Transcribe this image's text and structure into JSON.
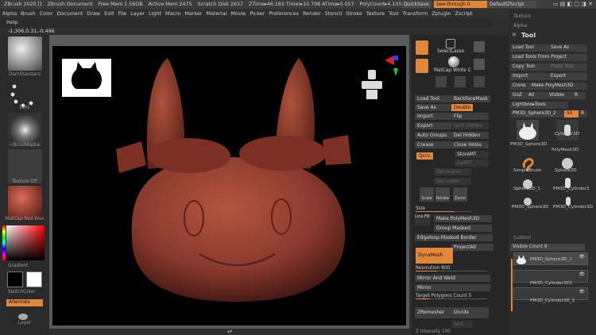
{
  "titlebar": {
    "app": "ZBrush 2020 []",
    "document": "ZBrush Document",
    "free_mem": "Free Mem 1.56GB",
    "active_mem": "Active Mem 2475",
    "scratch": "Scratch Disk 2637",
    "ztime": "ZTime▸46.183 Timer▸10.798 ATime▸0.057",
    "polycount": "PolyCount▸4.105 MP",
    "mi": "M…",
    "quicksave": "QuickSave",
    "see_through": "See-through  0",
    "script": "DefaultZScript"
  },
  "menu": [
    "Alpha",
    "Brush",
    "Color",
    "Document",
    "Draw",
    "Edit",
    "File",
    "Layer",
    "Light",
    "Macro",
    "Marker",
    "Material",
    "Movie",
    "Picker",
    "Preferences",
    "Render",
    "Stencil",
    "Stroke",
    "Texture",
    "Tool",
    "Transform",
    "Zplugin",
    "Zscript"
  ],
  "help": "Help",
  "coords": "-1.306,0.31,-0.496",
  "left_shelf": {
    "brush_label": "DamStandard",
    "stroke_label": "Dots",
    "alpha_label": "~BrushAlpha",
    "texture_label": "Texture Off",
    "material_label": "MatCap Red Wax",
    "gradient_label": "Gradient",
    "switch_label": "SwitchColor",
    "alternate_label": "Alternate",
    "layer_label": "Layer"
  },
  "center": {
    "lasso_label": "SelectLasso",
    "matcap_label": "MatCap White C",
    "brush_btns": [
      "Standard",
      "Clay Buildup",
      "Move",
      "Move Topo",
      "Smooth",
      "ZRemesher"
    ],
    "load_tool": "Load Tool",
    "backface": "BackfaceMask",
    "save_as": "Save As",
    "double": "Double",
    "import": "Import",
    "flip": "Flip",
    "export": "Export",
    "split_hidden": "Split Hidden",
    "auto_groups": "Auto Groups",
    "del_hidden": "Del Hidden",
    "crease": "Crease",
    "close_holes": "Close Holes",
    "qcrv": "Qcrv",
    "store_mt": "StoreMT",
    "del_mt": "DelMT",
    "del_higher": "Del Higher",
    "del_lower": "Del Lower",
    "scale": "Scale",
    "rotate": "Rotate",
    "zoom": "Zoom",
    "size_label": "Size",
    "size_value": 0.7,
    "linefill": "Line Fill",
    "make_polymesh": "Make PolyMesh3D",
    "group_masked": "Group Masked",
    "edgeloop": "Edgeloop Masked Border",
    "project_all": "ProjectAll",
    "dynamesh": "DynaMesh",
    "resolution": "Resolution 800",
    "mirror_weld": "Mirror And Weld",
    "mirror": "Mirror",
    "target_poly": "Target Polygons Count 5",
    "zremesher": "ZRemesher",
    "divide": "Divide",
    "smt": "Smt",
    "zintensity": "Z Intensity 100",
    "bottom_info": "Draw Size 64"
  },
  "right": {
    "top_labels": [
      "Texture",
      "Alpha"
    ],
    "tool_title": "Tool",
    "load_tool": "Load Tool",
    "save_as": "Save As",
    "load_from_project": "Load Tools From Project",
    "copy_tool": "Copy Tool",
    "paste_tool": "Paste Tool",
    "import": "Import",
    "export": "Export",
    "clone": "Clone",
    "make_polymesh": "Make PolyMesh3D",
    "goz": "GoZ",
    "all": "All",
    "visible": "Visible",
    "r": "R",
    "lightbox_tools": "Lightbox▸Tools",
    "current_tool": "PM3D_Sphere3D_2",
    "current_value": "50",
    "thumbs": [
      "PM3D_Sphere3D",
      "PolyMesh3D",
      "SimpleBrush",
      "Sphere3D",
      "Sphere3D_1",
      "PM3D_Cylinder3",
      "PM3D_Sphere3D",
      "PM3D_Cylinder3D"
    ],
    "cylinder_label": "Cylinder3D",
    "subtool_header": "Subtool",
    "visible_count": "Visible Count 8",
    "subtools": [
      "PM3D_Sphere3D_2",
      "PM3D_Cylinder3D1",
      "PM3D_Cylinder3D_2"
    ]
  },
  "colors": {
    "accent": "#e1873a",
    "bg": "#2e2e2e",
    "model": "#8a3a2e"
  }
}
